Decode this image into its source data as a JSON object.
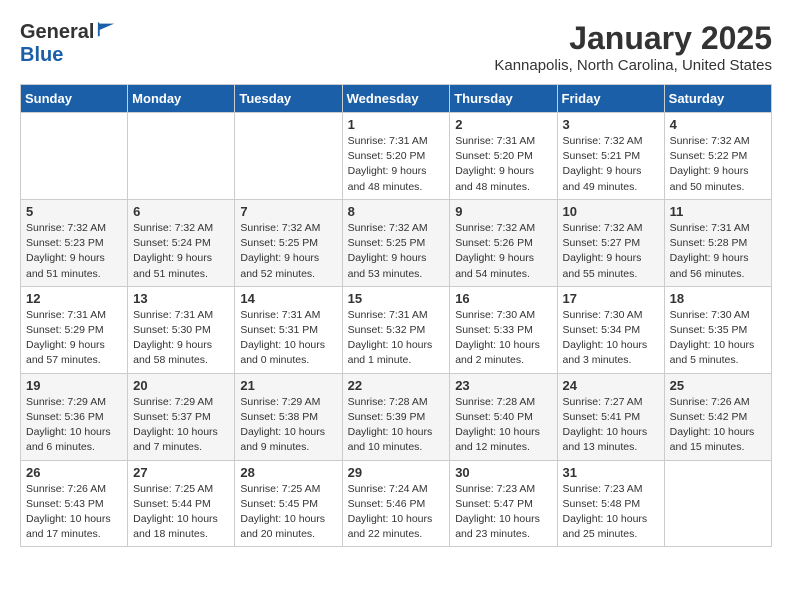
{
  "logo": {
    "general": "General",
    "blue": "Blue"
  },
  "title": "January 2025",
  "subtitle": "Kannapolis, North Carolina, United States",
  "weekdays": [
    "Sunday",
    "Monday",
    "Tuesday",
    "Wednesday",
    "Thursday",
    "Friday",
    "Saturday"
  ],
  "weeks": [
    [
      {
        "day": "",
        "info": ""
      },
      {
        "day": "",
        "info": ""
      },
      {
        "day": "",
        "info": ""
      },
      {
        "day": "1",
        "info": "Sunrise: 7:31 AM\nSunset: 5:20 PM\nDaylight: 9 hours\nand 48 minutes."
      },
      {
        "day": "2",
        "info": "Sunrise: 7:31 AM\nSunset: 5:20 PM\nDaylight: 9 hours\nand 48 minutes."
      },
      {
        "day": "3",
        "info": "Sunrise: 7:32 AM\nSunset: 5:21 PM\nDaylight: 9 hours\nand 49 minutes."
      },
      {
        "day": "4",
        "info": "Sunrise: 7:32 AM\nSunset: 5:22 PM\nDaylight: 9 hours\nand 50 minutes."
      }
    ],
    [
      {
        "day": "5",
        "info": "Sunrise: 7:32 AM\nSunset: 5:23 PM\nDaylight: 9 hours\nand 51 minutes."
      },
      {
        "day": "6",
        "info": "Sunrise: 7:32 AM\nSunset: 5:24 PM\nDaylight: 9 hours\nand 51 minutes."
      },
      {
        "day": "7",
        "info": "Sunrise: 7:32 AM\nSunset: 5:25 PM\nDaylight: 9 hours\nand 52 minutes."
      },
      {
        "day": "8",
        "info": "Sunrise: 7:32 AM\nSunset: 5:25 PM\nDaylight: 9 hours\nand 53 minutes."
      },
      {
        "day": "9",
        "info": "Sunrise: 7:32 AM\nSunset: 5:26 PM\nDaylight: 9 hours\nand 54 minutes."
      },
      {
        "day": "10",
        "info": "Sunrise: 7:32 AM\nSunset: 5:27 PM\nDaylight: 9 hours\nand 55 minutes."
      },
      {
        "day": "11",
        "info": "Sunrise: 7:31 AM\nSunset: 5:28 PM\nDaylight: 9 hours\nand 56 minutes."
      }
    ],
    [
      {
        "day": "12",
        "info": "Sunrise: 7:31 AM\nSunset: 5:29 PM\nDaylight: 9 hours\nand 57 minutes."
      },
      {
        "day": "13",
        "info": "Sunrise: 7:31 AM\nSunset: 5:30 PM\nDaylight: 9 hours\nand 58 minutes."
      },
      {
        "day": "14",
        "info": "Sunrise: 7:31 AM\nSunset: 5:31 PM\nDaylight: 10 hours\nand 0 minutes."
      },
      {
        "day": "15",
        "info": "Sunrise: 7:31 AM\nSunset: 5:32 PM\nDaylight: 10 hours\nand 1 minute."
      },
      {
        "day": "16",
        "info": "Sunrise: 7:30 AM\nSunset: 5:33 PM\nDaylight: 10 hours\nand 2 minutes."
      },
      {
        "day": "17",
        "info": "Sunrise: 7:30 AM\nSunset: 5:34 PM\nDaylight: 10 hours\nand 3 minutes."
      },
      {
        "day": "18",
        "info": "Sunrise: 7:30 AM\nSunset: 5:35 PM\nDaylight: 10 hours\nand 5 minutes."
      }
    ],
    [
      {
        "day": "19",
        "info": "Sunrise: 7:29 AM\nSunset: 5:36 PM\nDaylight: 10 hours\nand 6 minutes."
      },
      {
        "day": "20",
        "info": "Sunrise: 7:29 AM\nSunset: 5:37 PM\nDaylight: 10 hours\nand 7 minutes."
      },
      {
        "day": "21",
        "info": "Sunrise: 7:29 AM\nSunset: 5:38 PM\nDaylight: 10 hours\nand 9 minutes."
      },
      {
        "day": "22",
        "info": "Sunrise: 7:28 AM\nSunset: 5:39 PM\nDaylight: 10 hours\nand 10 minutes."
      },
      {
        "day": "23",
        "info": "Sunrise: 7:28 AM\nSunset: 5:40 PM\nDaylight: 10 hours\nand 12 minutes."
      },
      {
        "day": "24",
        "info": "Sunrise: 7:27 AM\nSunset: 5:41 PM\nDaylight: 10 hours\nand 13 minutes."
      },
      {
        "day": "25",
        "info": "Sunrise: 7:26 AM\nSunset: 5:42 PM\nDaylight: 10 hours\nand 15 minutes."
      }
    ],
    [
      {
        "day": "26",
        "info": "Sunrise: 7:26 AM\nSunset: 5:43 PM\nDaylight: 10 hours\nand 17 minutes."
      },
      {
        "day": "27",
        "info": "Sunrise: 7:25 AM\nSunset: 5:44 PM\nDaylight: 10 hours\nand 18 minutes."
      },
      {
        "day": "28",
        "info": "Sunrise: 7:25 AM\nSunset: 5:45 PM\nDaylight: 10 hours\nand 20 minutes."
      },
      {
        "day": "29",
        "info": "Sunrise: 7:24 AM\nSunset: 5:46 PM\nDaylight: 10 hours\nand 22 minutes."
      },
      {
        "day": "30",
        "info": "Sunrise: 7:23 AM\nSunset: 5:47 PM\nDaylight: 10 hours\nand 23 minutes."
      },
      {
        "day": "31",
        "info": "Sunrise: 7:23 AM\nSunset: 5:48 PM\nDaylight: 10 hours\nand 25 minutes."
      },
      {
        "day": "",
        "info": ""
      }
    ]
  ]
}
